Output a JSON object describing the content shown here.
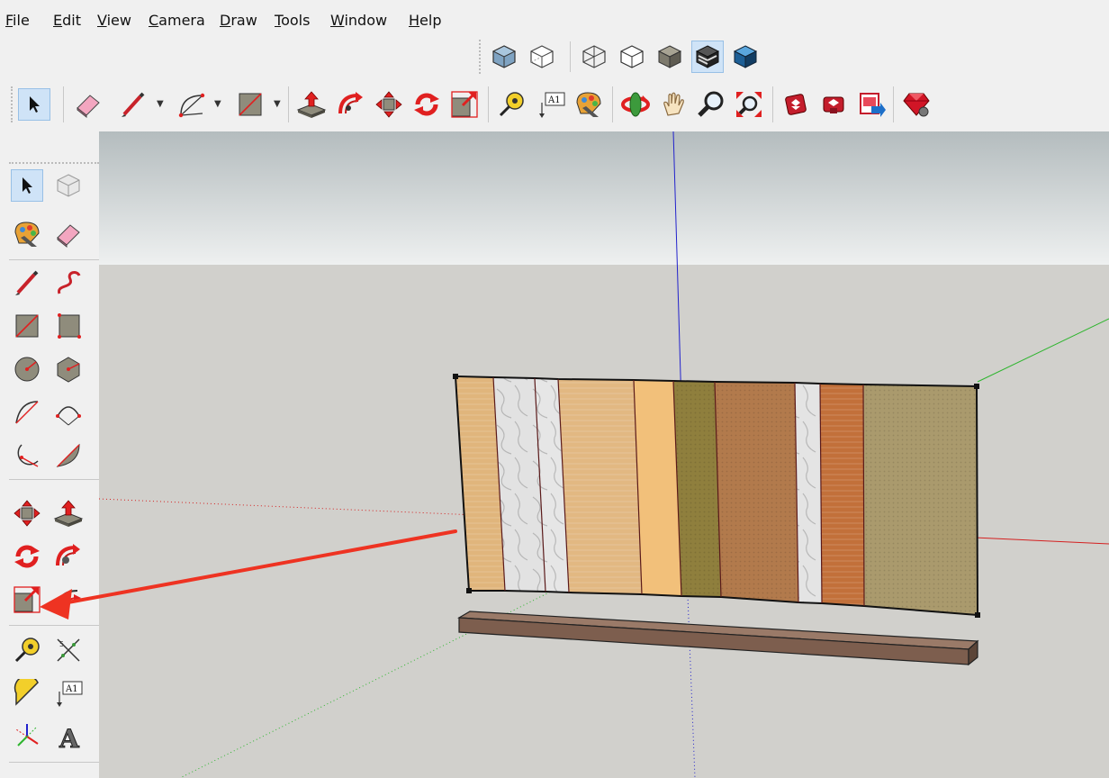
{
  "menubar": {
    "items": [
      "File",
      "Edit",
      "View",
      "Camera",
      "Draw",
      "Tools",
      "Window",
      "Help"
    ]
  },
  "toolbar_views": {
    "buttons": [
      "x-ray-icon",
      "back-edges-icon",
      "wireframe-icon",
      "hidden-line-icon",
      "shaded-icon",
      "shaded-with-textures-icon",
      "monochrome-icon"
    ],
    "active": "shaded-with-textures-icon"
  },
  "toolbar_main": {
    "buttons": [
      "select-icon",
      "eraser-icon",
      "line-icon",
      "arc-icon",
      "rectangle-icon",
      "push-pull-icon",
      "follow-me-icon",
      "move-icon",
      "rotate-icon",
      "scale-icon",
      "tape-measure-icon",
      "text-icon",
      "paint-bucket-icon",
      "orbit-icon",
      "pan-icon",
      "zoom-icon",
      "zoom-extents-icon",
      "warehouse-icon",
      "extension-warehouse-icon",
      "send-to-layout-icon",
      "ruby-console-icon"
    ],
    "active": "select-icon",
    "text_glyph": "A1"
  },
  "left_toolbar": {
    "buttons": [
      "select-icon",
      "make-component-icon",
      "paint-bucket-icon",
      "eraser-icon",
      "line-icon",
      "freehand-icon",
      "rectangle-icon",
      "rotated-rectangle-icon",
      "circle-icon",
      "polygon-icon",
      "arc-icon",
      "two-point-arc-icon",
      "three-point-arc-icon",
      "pie-icon",
      "move-icon",
      "push-pull-icon",
      "rotate-icon",
      "follow-me-icon",
      "scale-icon",
      "offset-icon",
      "tape-measure-icon",
      "dimension-icon",
      "protractor-icon",
      "text-icon",
      "axes-icon",
      "3d-text-icon"
    ],
    "active": "select-icon",
    "text_glyph": "A1",
    "text_3d_glyph": "A"
  },
  "annotation": {
    "arrow_color": "#ee3322",
    "points_to": "scale-icon"
  },
  "viewport": {
    "sky_top": "#b4bcbe",
    "sky_bottom": "#eef0f0",
    "ground": "#d1d0cc",
    "axis_red": "#d42020",
    "axis_green": "#2fb52f",
    "axis_blue": "#2222cc",
    "panels": [
      {
        "material": "light-wood",
        "color": "#e0b57c"
      },
      {
        "material": "white-marble",
        "color": "#e2e2e2"
      },
      {
        "material": "white-marble",
        "color": "#e6e6e6"
      },
      {
        "material": "light-wood",
        "color": "#e2b882"
      },
      {
        "material": "pale-orange",
        "color": "#f2c07a"
      },
      {
        "material": "olive-fabric",
        "color": "#8f7f3d"
      },
      {
        "material": "brown-wood",
        "color": "#b27a4c"
      },
      {
        "material": "white-marble",
        "color": "#e4e4e4"
      },
      {
        "material": "orange-wood",
        "color": "#c2703a"
      },
      {
        "material": "khaki-fabric",
        "color": "#aa9a6d"
      }
    ],
    "beam_color": "#7d5e4e"
  }
}
